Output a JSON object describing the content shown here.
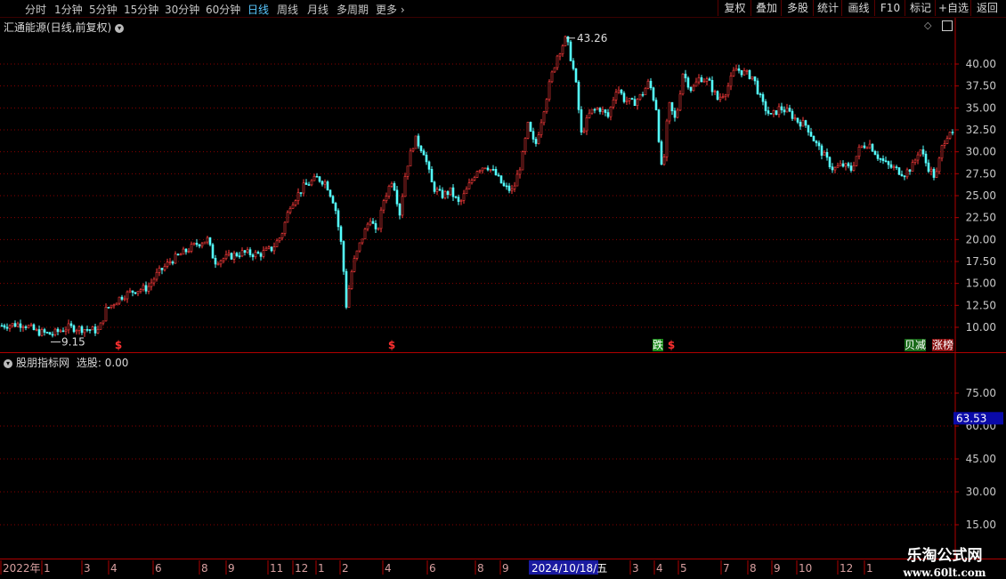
{
  "toolbar": {
    "timeframes": [
      "分时",
      "1分钟",
      "5分钟",
      "15分钟",
      "30分钟",
      "60分钟",
      "日线",
      "周线",
      "月线",
      "多周期",
      "更多"
    ],
    "active_timeframe": "日线",
    "right_buttons": [
      "复权",
      "叠加",
      "多股",
      "统计",
      "画线",
      "F10",
      "标记",
      "+自选",
      "返回"
    ]
  },
  "main_panel": {
    "title": "汇通能源(日线,前复权)",
    "high_label": "43.26",
    "low_label": "9.15",
    "signal_tags": [
      "$",
      "$",
      "跌",
      "$",
      "贝减",
      "涨榜"
    ]
  },
  "indicator_panel": {
    "title": "股朋指标网",
    "value_label": "选股: 0.00",
    "current_value": "63.53"
  },
  "date_axis": {
    "labels": [
      "2022年",
      "1",
      "3",
      "4",
      "6",
      "8",
      "9",
      "11",
      "12",
      "1",
      "2",
      "4",
      "6",
      "8",
      "9",
      "2024/10/18/五",
      "3",
      "4",
      "5",
      "7",
      "8",
      "9",
      "10",
      "12",
      "1"
    ]
  },
  "watermark": {
    "line1": "乐淘公式网",
    "line2": "www.60lt.com"
  },
  "colors": {
    "up": "#ff3c3c",
    "down": "#54ffff",
    "grid": "#8a0000",
    "axis_text": "#c8c8c8",
    "active": "#59c8ff"
  },
  "chart_data": [
    {
      "type": "candlestick",
      "ylim": [
        7.5,
        45
      ],
      "yticks": [
        10.0,
        12.5,
        15.0,
        17.5,
        20.0,
        22.5,
        25.0,
        27.5,
        30.0,
        32.5,
        35.0,
        37.5,
        40.0
      ],
      "grid": true,
      "close_path": [
        [
          0,
          10.2
        ],
        [
          25,
          10.4
        ],
        [
          40,
          9.5
        ],
        [
          57,
          9.2
        ],
        [
          75,
          10.0
        ],
        [
          95,
          9.8
        ],
        [
          110,
          9.6
        ],
        [
          118,
          12.0
        ],
        [
          135,
          13.5
        ],
        [
          150,
          14.2
        ],
        [
          165,
          14.5
        ],
        [
          175,
          16.0
        ],
        [
          190,
          17.5
        ],
        [
          205,
          18.5
        ],
        [
          220,
          19.5
        ],
        [
          232,
          20.0
        ],
        [
          240,
          17.5
        ],
        [
          255,
          18.0
        ],
        [
          270,
          18.5
        ],
        [
          290,
          18.3
        ],
        [
          305,
          19.0
        ],
        [
          315,
          20.5
        ],
        [
          325,
          24.0
        ],
        [
          340,
          26.0
        ],
        [
          355,
          27.0
        ],
        [
          365,
          26.5
        ],
        [
          375,
          24.0
        ],
        [
          383,
          19.0
        ],
        [
          388,
          12.5
        ],
        [
          395,
          17.0
        ],
        [
          405,
          20.0
        ],
        [
          415,
          22.5
        ],
        [
          422,
          20.5
        ],
        [
          430,
          24.5
        ],
        [
          440,
          27.0
        ],
        [
          448,
          23.0
        ],
        [
          455,
          28.0
        ],
        [
          465,
          31.5
        ],
        [
          475,
          30.0
        ],
        [
          485,
          26.0
        ],
        [
          495,
          25.0
        ],
        [
          505,
          25.5
        ],
        [
          515,
          24.0
        ],
        [
          525,
          26.0
        ],
        [
          535,
          28.0
        ],
        [
          545,
          28.5
        ],
        [
          555,
          27.5
        ],
        [
          565,
          26.0
        ],
        [
          575,
          25.5
        ],
        [
          585,
          29.0
        ],
        [
          592,
          33.0
        ],
        [
          600,
          30.5
        ],
        [
          610,
          35.0
        ],
        [
          618,
          38.5
        ],
        [
          625,
          41.0
        ],
        [
          635,
          43.0
        ],
        [
          645,
          38.5
        ],
        [
          652,
          32.0
        ],
        [
          662,
          34.5
        ],
        [
          672,
          35.0
        ],
        [
          682,
          34.0
        ],
        [
          692,
          37.5
        ],
        [
          700,
          36.0
        ],
        [
          710,
          35.5
        ],
        [
          720,
          36.5
        ],
        [
          728,
          38.0
        ],
        [
          736,
          35.0
        ],
        [
          743,
          27.0
        ],
        [
          750,
          35.5
        ],
        [
          758,
          33.5
        ],
        [
          766,
          39.0
        ],
        [
          776,
          37.0
        ],
        [
          785,
          38.5
        ],
        [
          795,
          38.0
        ],
        [
          805,
          36.0
        ],
        [
          815,
          37.0
        ],
        [
          825,
          39.5
        ],
        [
          835,
          39.0
        ],
        [
          845,
          38.5
        ],
        [
          855,
          35.5
        ],
        [
          865,
          34.0
        ],
        [
          875,
          35.0
        ],
        [
          885,
          34.5
        ],
        [
          895,
          33.5
        ],
        [
          905,
          33.0
        ],
        [
          915,
          31.0
        ],
        [
          925,
          29.5
        ],
        [
          935,
          28.0
        ],
        [
          945,
          28.5
        ],
        [
          955,
          28.0
        ],
        [
          965,
          30.5
        ],
        [
          975,
          31.0
        ],
        [
          985,
          29.5
        ],
        [
          995,
          28.5
        ],
        [
          1005,
          28.0
        ],
        [
          1015,
          27.5
        ],
        [
          1025,
          28.5
        ],
        [
          1032,
          30.5
        ],
        [
          1040,
          28.5
        ],
        [
          1050,
          27.0
        ],
        [
          1058,
          31.0
        ],
        [
          1066,
          32.5
        ],
        [
          1070,
          31.5
        ]
      ],
      "annotations": [
        {
          "label": "43.26",
          "value": 43.26
        },
        {
          "label": "9.15",
          "value": 9.15
        }
      ]
    },
    {
      "type": "line",
      "title": "股朋指标网",
      "yticks": [
        15.0,
        30.0,
        45.0,
        60.0,
        75.0
      ],
      "ylim": [
        10,
        100
      ],
      "current_value": 63.53,
      "grid": true
    }
  ]
}
